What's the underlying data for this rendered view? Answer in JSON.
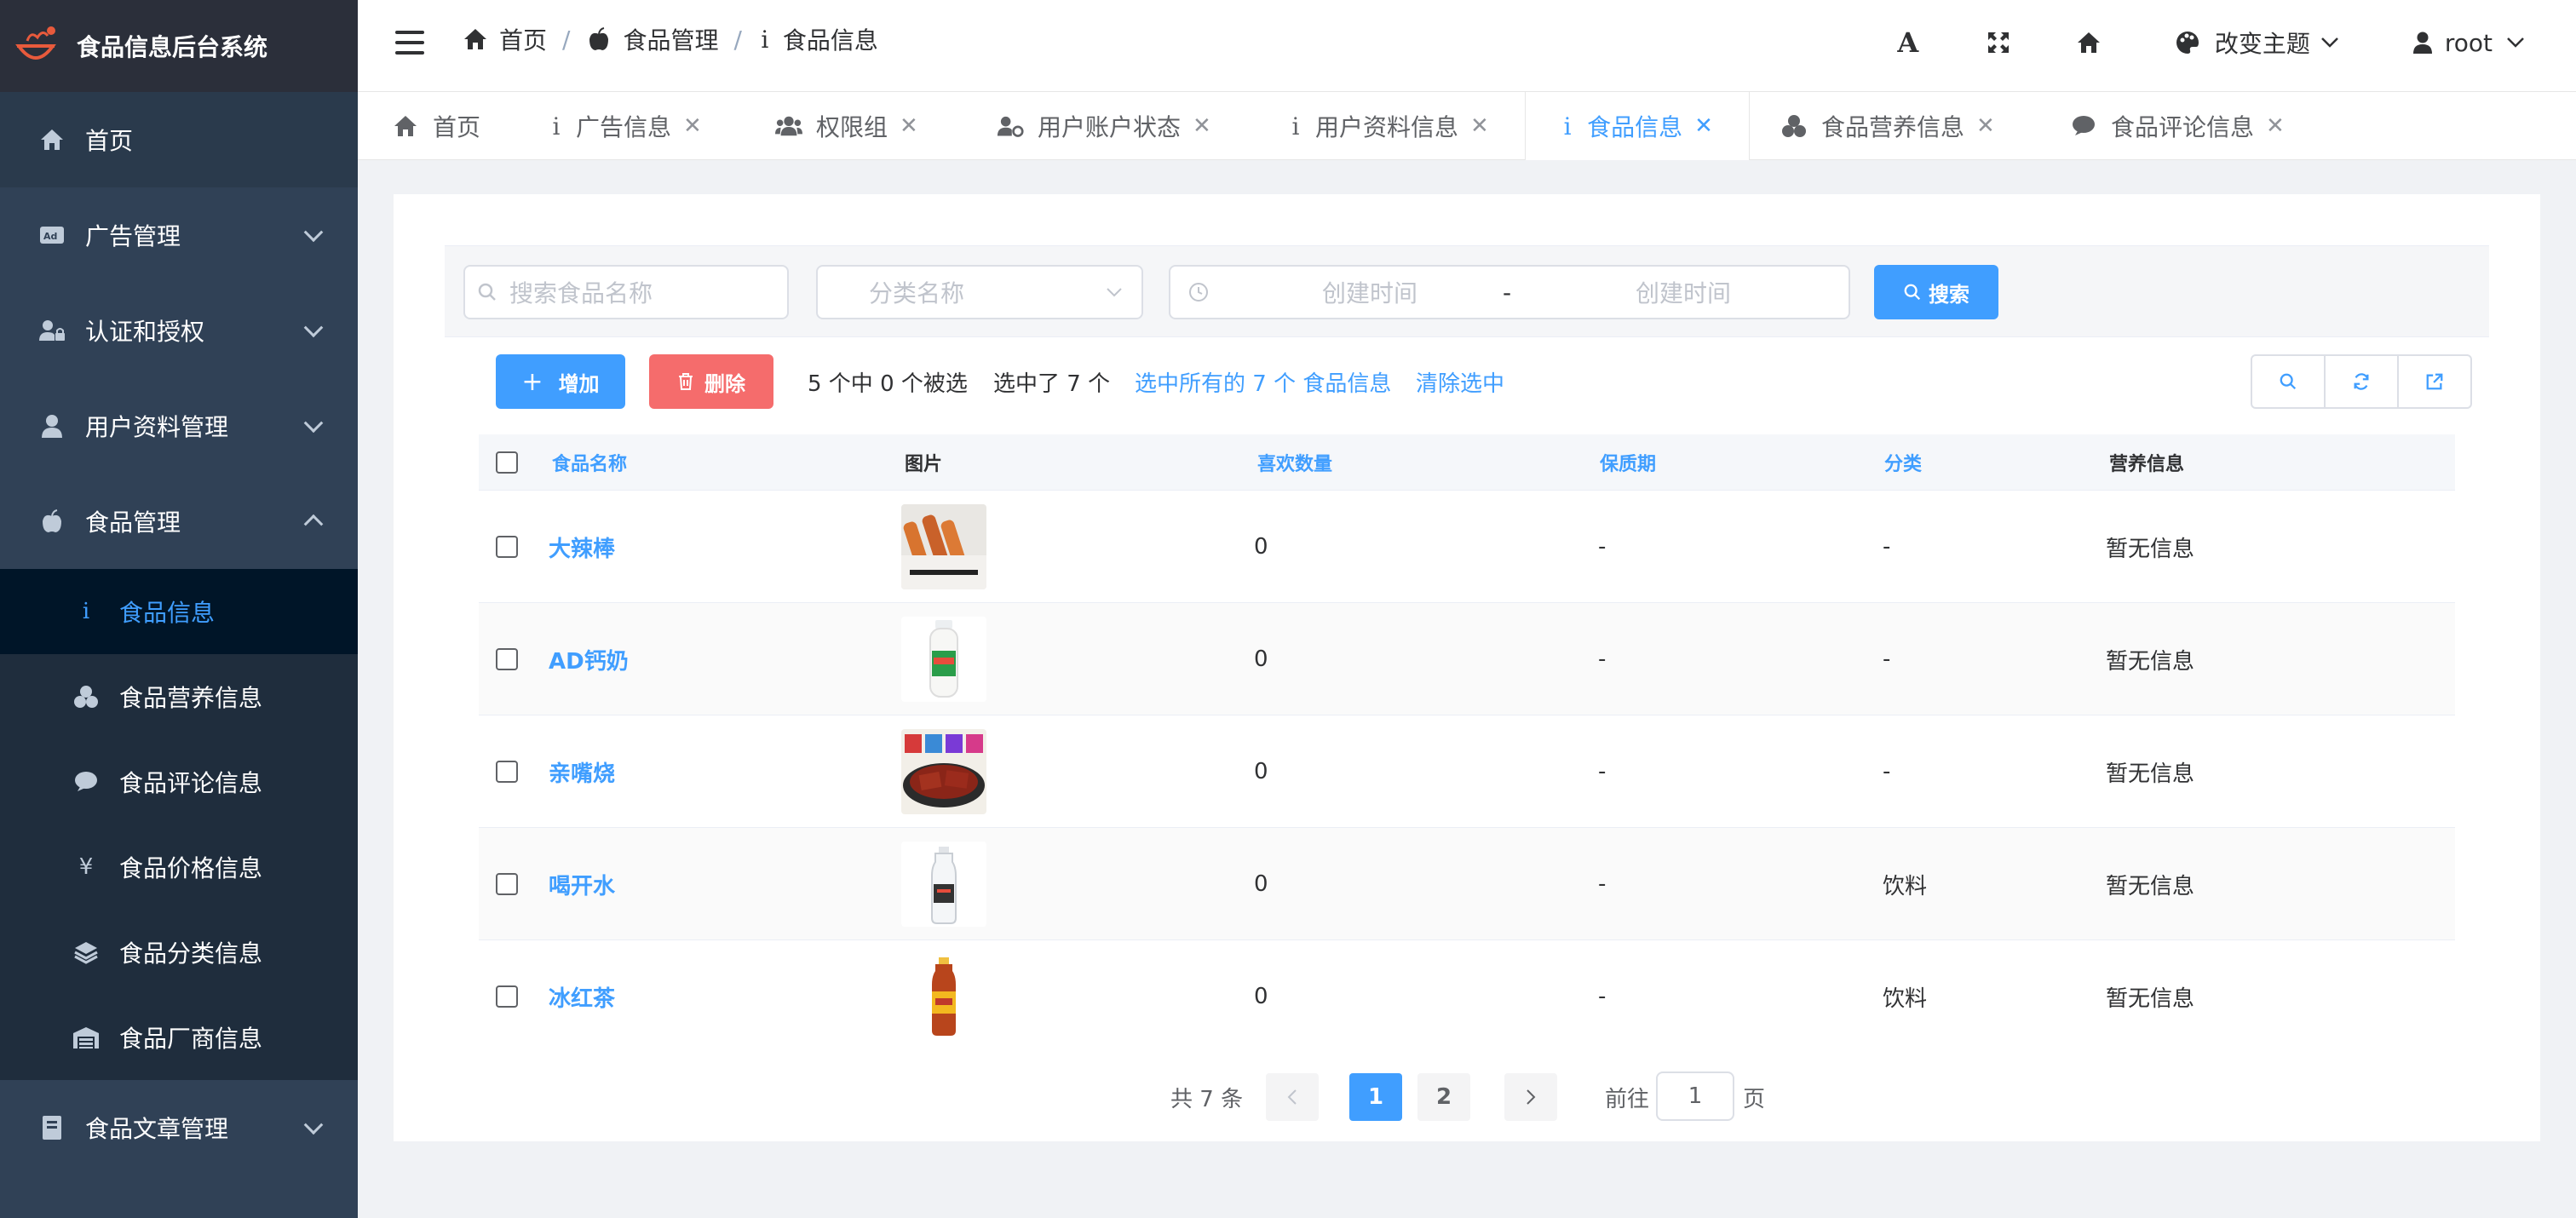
{
  "app": {
    "title": "食品信息后台系统"
  },
  "colors": {
    "sidebar": "#304156",
    "accent": "#409eff",
    "danger": "#f56c6c"
  },
  "sidebar": {
    "items": [
      {
        "label": "首页",
        "icon": "home-icon"
      },
      {
        "label": "广告管理",
        "icon": "ad-icon"
      },
      {
        "label": "认证和授权",
        "icon": "user-lock-icon"
      },
      {
        "label": "用户资料管理",
        "icon": "user-icon"
      },
      {
        "label": "食品管理",
        "icon": "apple-icon"
      },
      {
        "label": "食品文章管理",
        "icon": "book-icon"
      }
    ],
    "submenu": [
      {
        "label": "食品信息",
        "icon": "info-icon"
      },
      {
        "label": "食品营养信息",
        "icon": "cubes-icon"
      },
      {
        "label": "食品评论信息",
        "icon": "comment-icon"
      },
      {
        "label": "食品价格信息",
        "icon": "yen-icon"
      },
      {
        "label": "食品分类信息",
        "icon": "layers-icon"
      },
      {
        "label": "食品厂商信息",
        "icon": "warehouse-icon"
      }
    ]
  },
  "breadcrumb": [
    "首页",
    "食品管理",
    "食品信息"
  ],
  "navbar": {
    "theme_label": "改变主题",
    "user": "root"
  },
  "tags": [
    {
      "label": "首页"
    },
    {
      "label": "广告信息"
    },
    {
      "label": "权限组"
    },
    {
      "label": "用户账户状态"
    },
    {
      "label": "用户资料信息"
    },
    {
      "label": "食品信息"
    },
    {
      "label": "食品营养信息"
    },
    {
      "label": "食品评论信息"
    }
  ],
  "search": {
    "name_placeholder": "搜索食品名称",
    "category_placeholder": "分类名称",
    "start_placeholder": "创建时间",
    "range_sep": "-",
    "end_placeholder": "创建时间",
    "button": "搜索"
  },
  "toolbar": {
    "add": "增加",
    "delete": "删除",
    "selection_info": "5 个中 0 个被选",
    "selected_count": "选中了 7 个",
    "select_all": "选中所有的 7 个 食品信息",
    "clear": "清除选中"
  },
  "table": {
    "headers": [
      "食品名称",
      "图片",
      "喜欢数量",
      "保质期",
      "分类",
      "营养信息"
    ],
    "rows": [
      {
        "name": "大辣棒",
        "likes": "0",
        "shelf_life": "-",
        "category": "-",
        "nutrition": "暂无信息"
      },
      {
        "name": "AD钙奶",
        "likes": "0",
        "shelf_life": "-",
        "category": "-",
        "nutrition": "暂无信息"
      },
      {
        "name": "亲嘴烧",
        "likes": "0",
        "shelf_life": "-",
        "category": "-",
        "nutrition": "暂无信息"
      },
      {
        "name": "喝开水",
        "likes": "0",
        "shelf_life": "-",
        "category": "饮料",
        "nutrition": "暂无信息"
      },
      {
        "name": "冰红茶",
        "likes": "0",
        "shelf_life": "-",
        "category": "饮料",
        "nutrition": "暂无信息"
      }
    ]
  },
  "pagination": {
    "total": "共 7 条",
    "pages": [
      "1",
      "2"
    ],
    "goto_label": "前往",
    "goto_value": "1",
    "page_suffix": "页"
  }
}
